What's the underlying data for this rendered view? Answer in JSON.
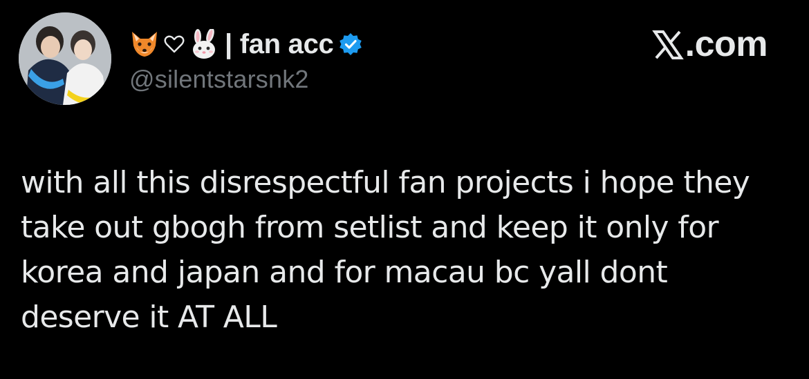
{
  "author": {
    "display_name": "| fan acc",
    "handle": "@silentstarsnk2",
    "name_emojis": [
      "fox-icon",
      "heart-icon",
      "rabbit-icon"
    ],
    "verified": true,
    "verified_color": "#1d9bf0"
  },
  "watermark": {
    "text": ".com",
    "logo": "x-logo"
  },
  "tweet": {
    "text": "with all this disrespectful fan projects i hope they\ntake out gbogh from setlist and keep it only for\nkorea and japan and for macau bc yall dont\ndeserve it  AT ALL"
  },
  "colors": {
    "background": "#000000",
    "text_primary": "#e7e9ea",
    "text_secondary": "#71767b"
  }
}
